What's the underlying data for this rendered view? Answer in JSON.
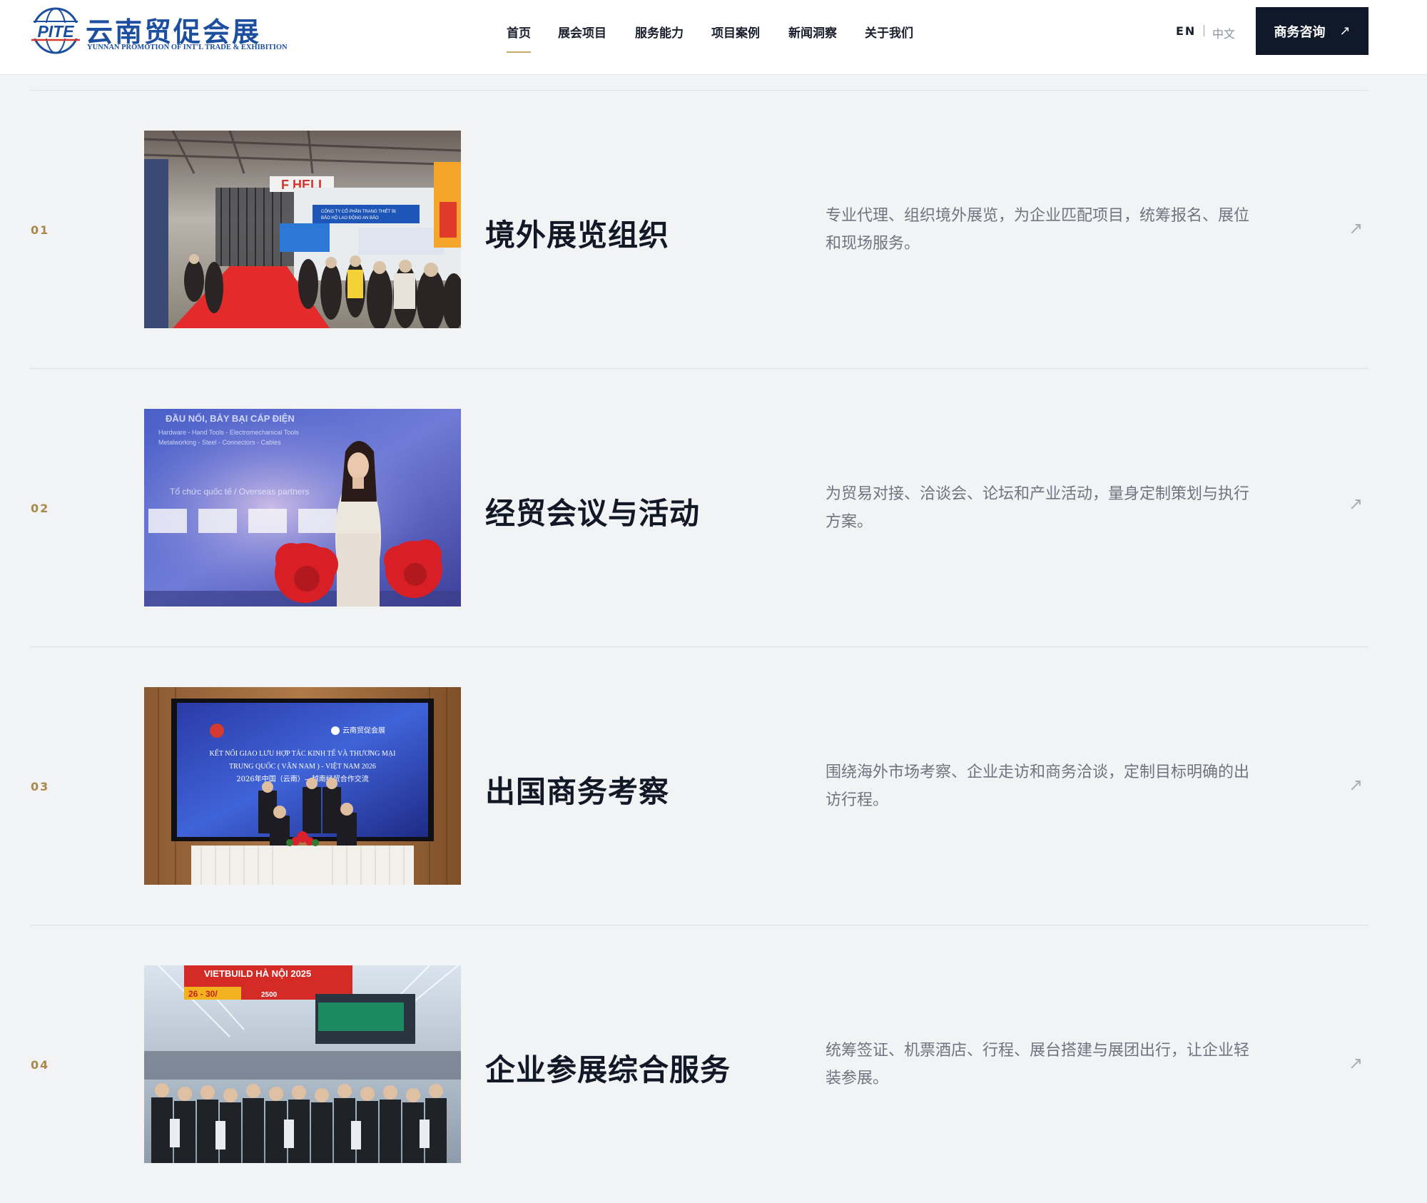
{
  "header": {
    "logo": {
      "mark_text": "PITE",
      "name_cn": "云南贸促会展",
      "name_en": "YUNNAN PROMOTION OF INT'L TRADE & EXHIBITION"
    },
    "nav": [
      {
        "label": "首页",
        "active": true
      },
      {
        "label": "展会项目",
        "active": false
      },
      {
        "label": "服务能力",
        "active": false
      },
      {
        "label": "项目案例",
        "active": false
      },
      {
        "label": "新闻洞察",
        "active": false
      },
      {
        "label": "关于我们",
        "active": false
      }
    ],
    "lang_en": "EN",
    "lang_cn": "中文",
    "cta_label": "商务咨询",
    "cta_icon": "arrow-up-right-icon",
    "accent_color": "#c9a968",
    "brand_color": "#1d4fa0"
  },
  "services": [
    {
      "num": "01",
      "title": "境外展览组织",
      "desc": "专业代理、组织境外展览，为企业匹配项目，统筹报名、展位和现场服务。",
      "image_text": [
        "CÔNG TY CỔ PHẦN TRANG THIẾT BỊ",
        "BẢO HỘ LAO ĐỘNG AN BẢO"
      ]
    },
    {
      "num": "02",
      "title": "经贸会议与活动",
      "desc": "为贸易对接、洽谈会、论坛和产业活动，量身定制策划与执行方案。",
      "image_text": [
        "ĐẦU NỐI, BẢY BẠI CÁP ĐIỆN",
        "Hardware - Hand Tools - Electromechanical Tools",
        "Metalworking - Steel - Connectors - Cables",
        "Tổ chức quốc tế / Overseas partners"
      ]
    },
    {
      "num": "03",
      "title": "出国商务考察",
      "desc": "围绕海外市场考察、企业走访和商务洽谈，定制目标明确的出访行程。",
      "image_text": [
        "云南贸促会展",
        "KẾT NỐI GIAO LƯU HỢP TÁC KINH TẾ VÀ THƯƠNG MẠI",
        "TRUNG QUỐC ( VÂN NAM ) - VIỆT NAM 2026",
        "2026年中国（云南）—越南经贸合作交流"
      ]
    },
    {
      "num": "04",
      "title": "企业参展综合服务",
      "desc": "统筹签证、机票酒店、行程、展台搭建与展团出行，让企业轻装参展。",
      "image_text": [
        "VIETBUILD HÀ NỘI 2025",
        "26 - 30/",
        "2500"
      ]
    }
  ],
  "row_arrow_icon": "arrow-up-right-icon"
}
